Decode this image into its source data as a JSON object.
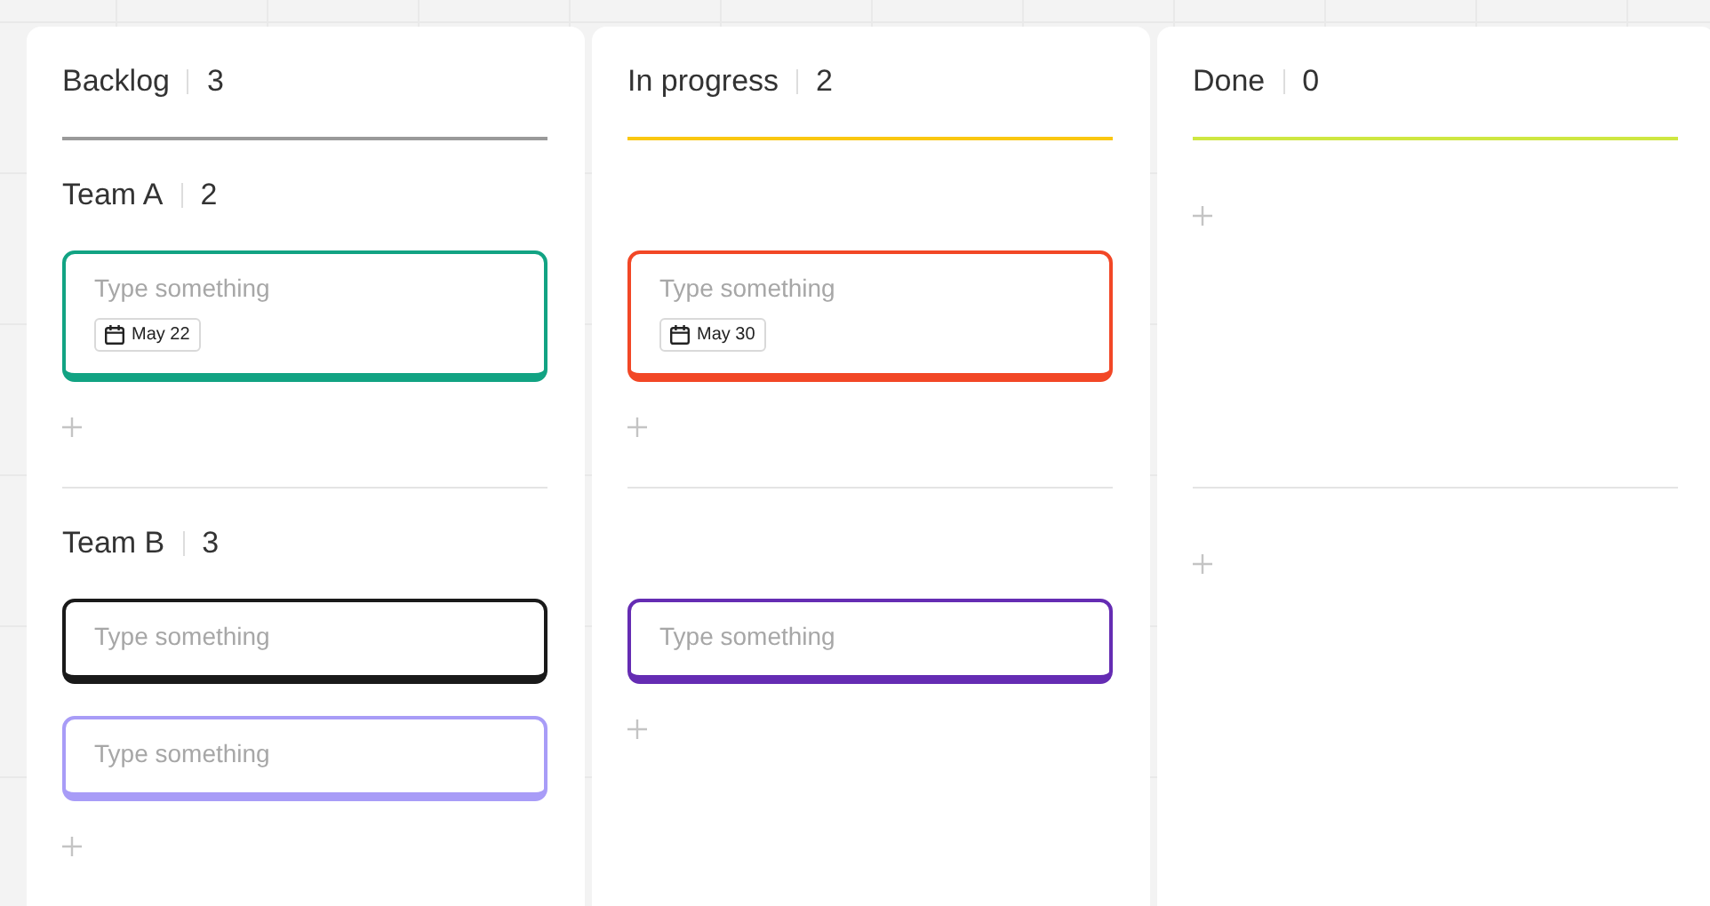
{
  "swimlanes": [
    {
      "name": "Team A",
      "count": "2"
    },
    {
      "name": "Team B",
      "count": "3"
    }
  ],
  "columns": [
    {
      "title": "Backlog",
      "count": "3",
      "color": "#9a9a9a",
      "lanes": [
        {
          "cards": [
            {
              "placeholder": "Type something",
              "color": "#12a383",
              "date": "May 22"
            }
          ]
        },
        {
          "cards": [
            {
              "placeholder": "Type something",
              "color": "#1a1a1a"
            },
            {
              "placeholder": "Type something",
              "color": "#a89cf7"
            }
          ]
        }
      ]
    },
    {
      "title": "In progress",
      "count": "2",
      "color": "#fac710",
      "lanes": [
        {
          "cards": [
            {
              "placeholder": "Type something",
              "color": "#f24726",
              "date": "May 30"
            }
          ]
        },
        {
          "cards": [
            {
              "placeholder": "Type something",
              "color": "#652cb3"
            }
          ]
        }
      ]
    },
    {
      "title": "Done",
      "count": "0",
      "color": "#cee741"
    }
  ]
}
